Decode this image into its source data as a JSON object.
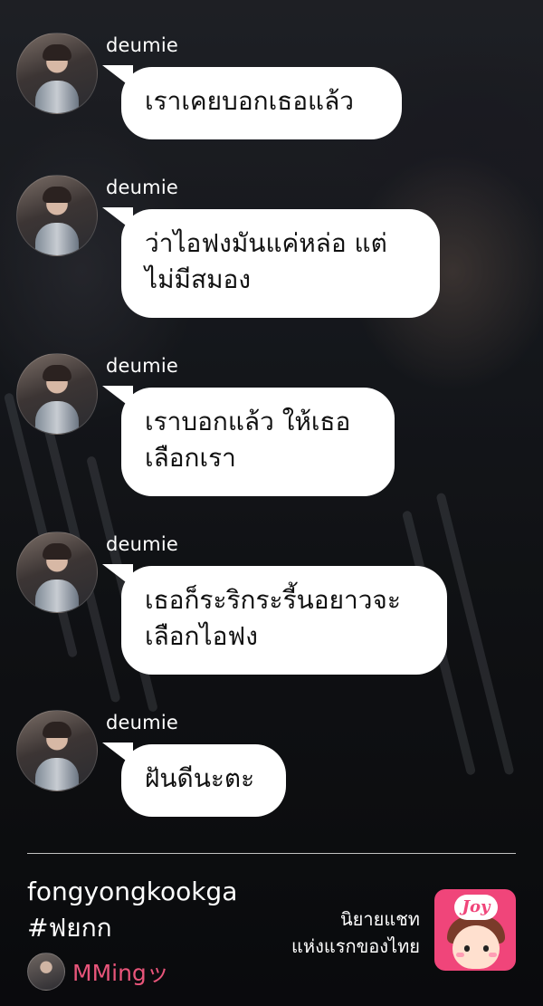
{
  "messages": [
    {
      "sender": "deumie",
      "text": "เราเคยบอกเธอแล้ว"
    },
    {
      "sender": "deumie",
      "text": "ว่าไอฟงมันแค่หล่อ แต่\nไม่มีสมอง"
    },
    {
      "sender": "deumie",
      "text": "เราบอกแล้ว ให้เธอ\nเลือกเรา"
    },
    {
      "sender": "deumie",
      "text": "เธอก็ระริกระรี้นอยาวจะ\nเลือกไอฟง"
    },
    {
      "sender": "deumie",
      "text": "ฝันดีนะตะ"
    }
  ],
  "footer": {
    "story_title": "fongyongkookga",
    "hashtag": "#ฟยกก",
    "author": "MMingッ",
    "promo_line1": "นิยายแชท",
    "promo_line2": "แห่งแรกของไทย",
    "logo_text": "Joy"
  },
  "colors": {
    "bubble": "#ffffff",
    "author_accent": "#e8557a",
    "logo_bg": "#f0457a"
  },
  "icons": {
    "sender_avatar": "avatar-photo-icon",
    "author_avatar": "author-avatar-icon",
    "app_logo": "joy-logo-icon"
  }
}
